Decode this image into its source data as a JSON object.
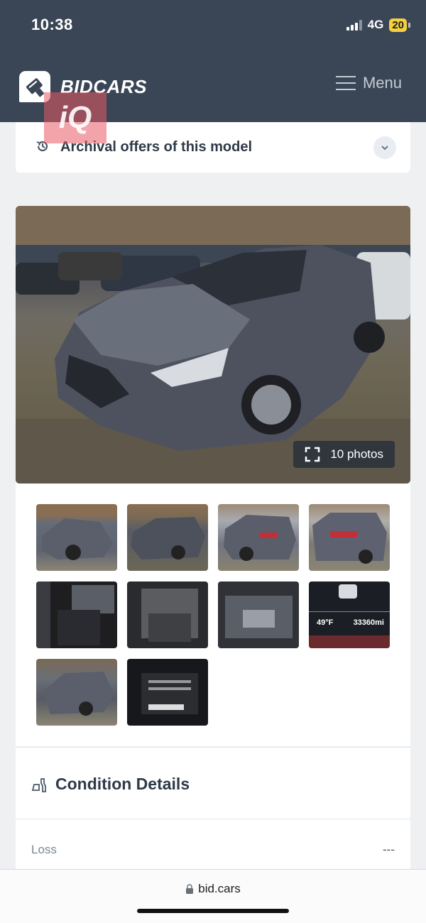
{
  "status_bar": {
    "time": "10:38",
    "network": "4G",
    "battery": "20"
  },
  "header": {
    "brand": "BIDCARS",
    "menu_label": "Menu",
    "watermark": "iQ"
  },
  "archive": {
    "title": "Archival offers of this model"
  },
  "gallery": {
    "main_photo_alt": "Damaged grey hatchback front left view",
    "photo_count_label": "10 photos",
    "thumbnails": [
      {
        "name": "front-left"
      },
      {
        "name": "front"
      },
      {
        "name": "rear-left"
      },
      {
        "name": "rear"
      },
      {
        "name": "interior-front"
      },
      {
        "name": "interior-rear"
      },
      {
        "name": "engine-bay"
      },
      {
        "name": "odometer",
        "temp": "49°F",
        "mileage": "33360mi"
      },
      {
        "name": "side-left"
      },
      {
        "name": "vin-label"
      }
    ]
  },
  "condition": {
    "title": "Condition Details",
    "rows": [
      {
        "label": "Loss",
        "value": "---"
      }
    ]
  },
  "browser": {
    "url": "bid.cars"
  }
}
